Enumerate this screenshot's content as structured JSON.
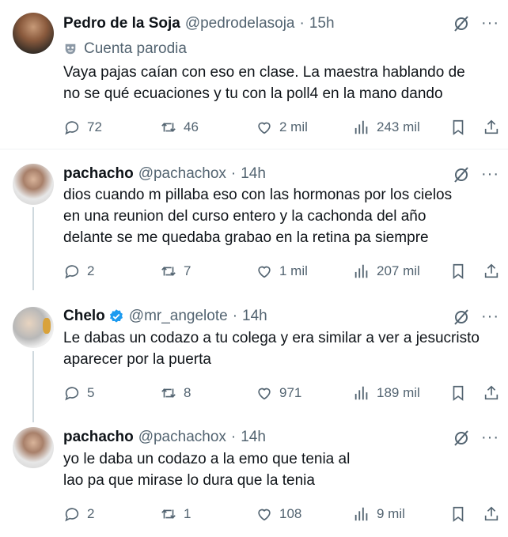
{
  "tweets": [
    {
      "name": "Pedro de la Soja",
      "handle": "@pedrodelasoja",
      "separator": "·",
      "time": "15h",
      "parody_label": "Cuenta parodia",
      "text_lines": [
        "Vaya pajas caían con eso en clase. La maestra hablando de",
        "no se qué ecuaciones y tu con la poll4 en la mano dando"
      ],
      "replies": "72",
      "retweets": "46",
      "likes": "2 mil",
      "views": "243 mil"
    },
    {
      "name": "pachacho",
      "handle": "@pachachox",
      "separator": "·",
      "time": "14h",
      "text_lines": [
        "dios cuando m pillaba eso con las hormonas por los cielos",
        "en una reunion del curso entero y la cachonda del año",
        "delante se me quedaba grabao en la retina pa siempre"
      ],
      "replies": "2",
      "retweets": "7",
      "likes": "1 mil",
      "views": "207 mil"
    },
    {
      "name": "Chelo",
      "handle": "@mr_angelote",
      "separator": "·",
      "time": "14h",
      "text_lines": [
        "Le dabas un codazo a tu colega y era similar a ver a jesucristo",
        "aparecer por la puerta"
      ],
      "replies": "5",
      "retweets": "8",
      "likes": "971",
      "views": "189 mil"
    },
    {
      "name": "pachacho",
      "handle": "@pachachox",
      "separator": "·",
      "time": "14h",
      "text_lines": [
        "yo le daba un codazo a la emo que tenia al",
        "lao pa que mirase lo dura que la tenia"
      ],
      "replies": "2",
      "retweets": "1",
      "likes": "108",
      "views": "9 mil"
    }
  ],
  "more_glyph": "···",
  "colors": {
    "text": "#0f1419",
    "secondary": "#536471",
    "verified": "#1d9bf0",
    "thread_line": "#cfd9de",
    "divider": "#eff3f4"
  },
  "icons": [
    "reply-icon",
    "retweet-icon",
    "like-icon",
    "views-icon",
    "bookmark-icon",
    "share-icon",
    "grok-icon",
    "more-icon",
    "verified-badge-icon",
    "parody-mask-icon"
  ]
}
